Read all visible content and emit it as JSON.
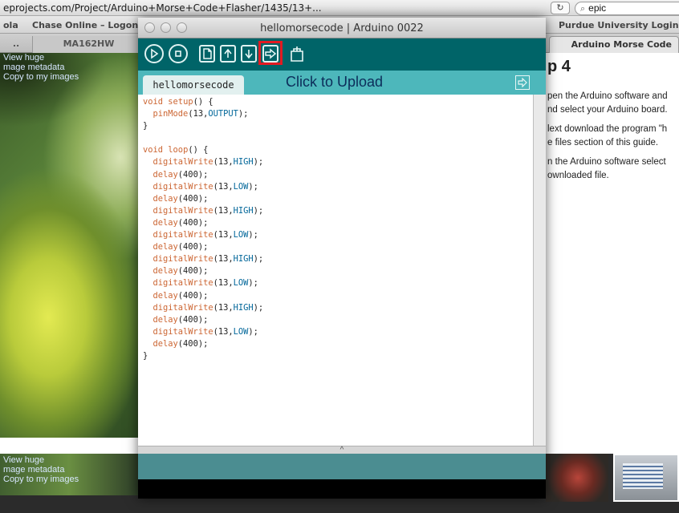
{
  "browser": {
    "url": "eprojects.com/Project/Arduino+Morse+Code+Flasher/1435/13+...",
    "reload_icon": "↻",
    "search_value": "epic",
    "search_icon": "⌕",
    "bookmarks": [
      "ola",
      "Chase Online – Logon",
      "Purdue University Login"
    ],
    "tabs": [
      "..",
      "MA162HW",
      "Arduino Morse Code"
    ]
  },
  "guide_page": {
    "step_heading": "p 4",
    "lines": [
      "pen the Arduino software and",
      "nd select your Arduino board.",
      "lext download the program \"h",
      "e files section of this guide.",
      "n the Arduino software select",
      "ownloaded file."
    ],
    "photo_links_top": [
      "View huge",
      "mage metadata",
      "Copy to my images"
    ],
    "photo_links_bottom": [
      "View huge",
      "mage metadata",
      "Copy to my images"
    ]
  },
  "arduino": {
    "window_title": "hellomorsecode | Arduino 0022",
    "toolbar_icons": [
      "verify-icon",
      "stop-icon",
      "new-icon",
      "open-icon",
      "save-icon",
      "upload-icon",
      "serial-monitor-icon"
    ],
    "tab_name": "hellomorsecode",
    "annotation": "Click to Upload",
    "code": [
      "void setup() {",
      "  pinMode(13,OUTPUT);",
      "}",
      "",
      "void loop() {",
      "  digitalWrite(13,HIGH);",
      "  delay(400);",
      "  digitalWrite(13,LOW);",
      "  delay(400);",
      "  digitalWrite(13,HIGH);",
      "  delay(400);",
      "  digitalWrite(13,LOW);",
      "  delay(400);",
      "  digitalWrite(13,HIGH);",
      "  delay(400);",
      "  digitalWrite(13,LOW);",
      "  delay(400);",
      "  digitalWrite(13,HIGH);",
      "  delay(400);",
      "  digitalWrite(13,LOW);",
      "  delay(400);",
      "}"
    ],
    "divider_arrow": "^"
  },
  "colors": {
    "arduino_teal": "#006468",
    "tab_bar": "#4db7bb",
    "highlight": "#e11b22",
    "keyword": "#cc6633",
    "constant": "#006699"
  }
}
